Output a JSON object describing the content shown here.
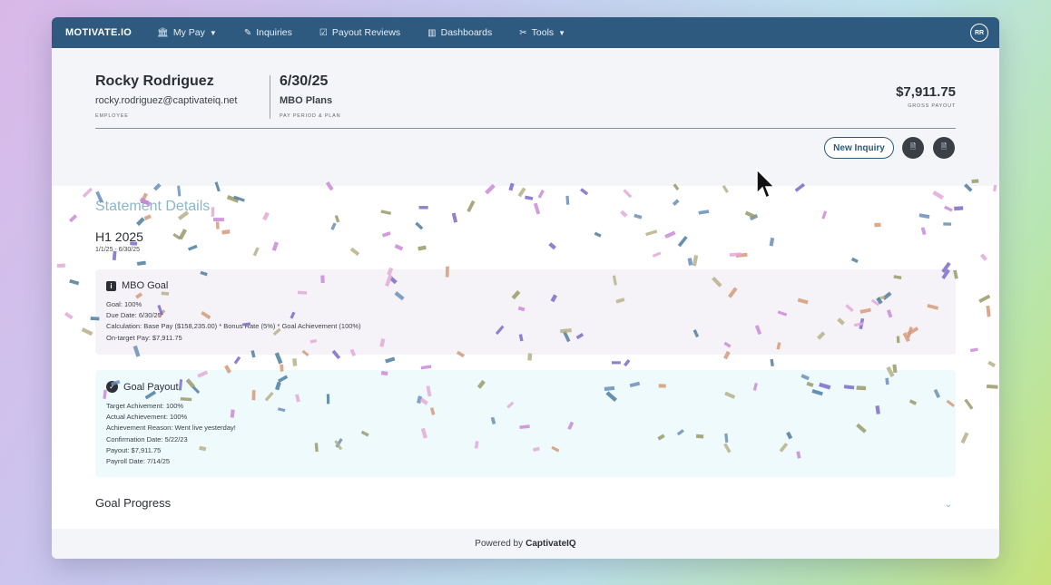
{
  "navbar": {
    "brand": "MOTIVATE.IO",
    "items": [
      {
        "label": "My Pay",
        "icon": "bank-icon",
        "dropdown": true
      },
      {
        "label": "Inquiries",
        "icon": "pencil-icon",
        "dropdown": false
      },
      {
        "label": "Payout Reviews",
        "icon": "checkbox-icon",
        "dropdown": false
      },
      {
        "label": "Dashboards",
        "icon": "bar-chart-icon",
        "dropdown": false
      },
      {
        "label": "Tools",
        "icon": "tools-icon",
        "dropdown": true
      }
    ],
    "avatar_initials": "RR",
    "bg_color": "#2d5a7e"
  },
  "header": {
    "employee_name": "Rocky Rodriguez",
    "employee_email": "rocky.rodriguez@captivateiq.net",
    "employee_caption": "EMPLOYEE",
    "period_date": "6/30/25",
    "plan_name": "MBO Plans",
    "period_caption": "PAY PERIOD & PLAN",
    "gross_amount": "$7,911.75",
    "gross_caption": "GROSS PAYOUT"
  },
  "actions": {
    "new_inquiry_label": "New Inquiry",
    "excel_icon": "excel-icon",
    "pdf_icon": "pdf-icon"
  },
  "statement": {
    "title": "Statement Details",
    "period_name": "H1 2025",
    "period_range": "1/1/25 - 6/30/25",
    "mbo_goal": {
      "title": "MBO Goal",
      "lines": [
        "Goal: 100%",
        "Due Date: 6/30/25",
        "Calculation: Base Pay ($158,235.00) * Bonus Rate (5%) * Goal Achievement (100%)",
        "On-target Pay: $7,911.75"
      ]
    },
    "goal_payout": {
      "title": "Goal Payout",
      "lines": [
        "Target Achivement: 100%",
        "Actual Achievement: 100%",
        "Achievement Reason: Went live yesterday!",
        "Confirmation Date: 5/22/23",
        "Payout: $7,911.75",
        "Payroll Date: 7/14/25"
      ]
    },
    "goal_progress_title": "Goal Progress"
  },
  "footer": {
    "prefix": "Powered by",
    "brand": "CaptivateIQ"
  }
}
